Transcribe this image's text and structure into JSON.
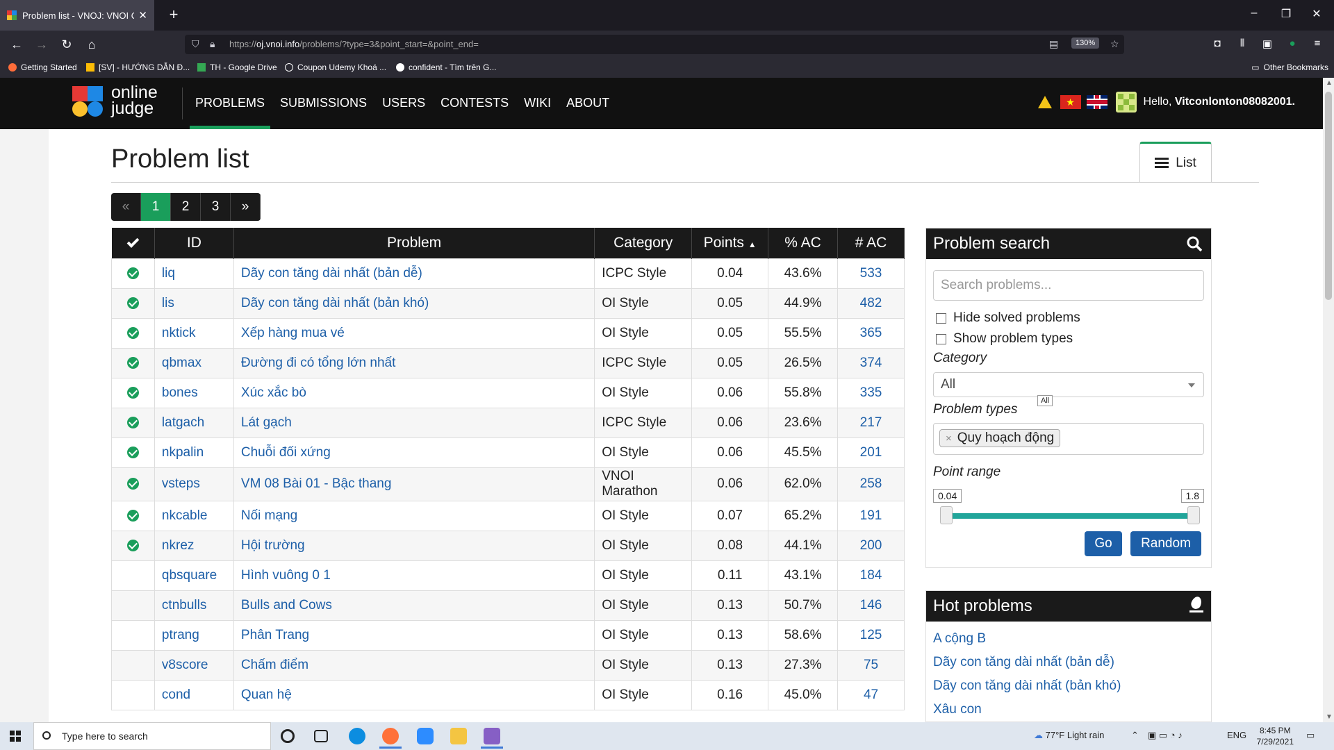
{
  "browser": {
    "tab_title": "Problem list - VNOJ: VNOI Onlin",
    "url_prefix": "https://",
    "url_host": "oj.vnoi.info",
    "url_path": "/problems/?type=3&point_start=&point_end=",
    "zoom": "130%",
    "bookmarks": [
      "Getting Started",
      "[SV] - HƯỚNG DẪN Đ...",
      "TH - Google Drive",
      "Coupon Udemy Khoá ...",
      "confident - Tìm trên G..."
    ],
    "other_bookmarks": "Other Bookmarks"
  },
  "site": {
    "logo_line1": "online",
    "logo_line2": "judge",
    "nav": [
      "PROBLEMS",
      "SUBMISSIONS",
      "USERS",
      "CONTESTS",
      "WIKI",
      "ABOUT"
    ],
    "hello_prefix": "Hello, ",
    "username": "Vitconlonton08082001."
  },
  "page": {
    "title": "Problem list",
    "list_tab": "List",
    "pager": [
      "«",
      "1",
      "2",
      "3",
      "»"
    ]
  },
  "table": {
    "headers": {
      "id": "ID",
      "problem": "Problem",
      "category": "Category",
      "points": "Points",
      "sort_indicator": "▲",
      "pct_ac": "% AC",
      "num_ac": "# AC"
    },
    "rows": [
      {
        "solved": true,
        "id": "liq",
        "name": "Dãy con tăng dài nhất (bản dễ)",
        "category": "ICPC Style",
        "points": "0.04",
        "pct": "43.6%",
        "ac": "533"
      },
      {
        "solved": true,
        "id": "lis",
        "name": "Dãy con tăng dài nhất (bản khó)",
        "category": "OI Style",
        "points": "0.05",
        "pct": "44.9%",
        "ac": "482"
      },
      {
        "solved": true,
        "id": "nktick",
        "name": "Xếp hàng mua vé",
        "category": "OI Style",
        "points": "0.05",
        "pct": "55.5%",
        "ac": "365"
      },
      {
        "solved": true,
        "id": "qbmax",
        "name": "Đường đi có tổng lớn nhất",
        "category": "ICPC Style",
        "points": "0.05",
        "pct": "26.5%",
        "ac": "374"
      },
      {
        "solved": true,
        "id": "bones",
        "name": "Xúc xắc bò",
        "category": "OI Style",
        "points": "0.06",
        "pct": "55.8%",
        "ac": "335"
      },
      {
        "solved": true,
        "id": "latgach",
        "name": "Lát gạch",
        "category": "ICPC Style",
        "points": "0.06",
        "pct": "23.6%",
        "ac": "217"
      },
      {
        "solved": true,
        "id": "nkpalin",
        "name": "Chuỗi đối xứng",
        "category": "OI Style",
        "points": "0.06",
        "pct": "45.5%",
        "ac": "201"
      },
      {
        "solved": true,
        "id": "vsteps",
        "name": "VM 08 Bài 01 - Bậc thang",
        "category": "VNOI Marathon",
        "points": "0.06",
        "pct": "62.0%",
        "ac": "258"
      },
      {
        "solved": true,
        "id": "nkcable",
        "name": "Nối mạng",
        "category": "OI Style",
        "points": "0.07",
        "pct": "65.2%",
        "ac": "191"
      },
      {
        "solved": true,
        "id": "nkrez",
        "name": "Hội trường",
        "category": "OI Style",
        "points": "0.08",
        "pct": "44.1%",
        "ac": "200"
      },
      {
        "solved": false,
        "id": "qbsquare",
        "name": "Hình vuông 0 1",
        "category": "OI Style",
        "points": "0.11",
        "pct": "43.1%",
        "ac": "184"
      },
      {
        "solved": false,
        "id": "ctnbulls",
        "name": "Bulls and Cows",
        "category": "OI Style",
        "points": "0.13",
        "pct": "50.7%",
        "ac": "146"
      },
      {
        "solved": false,
        "id": "ptrang",
        "name": "Phân Trang",
        "category": "OI Style",
        "points": "0.13",
        "pct": "58.6%",
        "ac": "125"
      },
      {
        "solved": false,
        "id": "v8score",
        "name": "Chấm điểm",
        "category": "OI Style",
        "points": "0.13",
        "pct": "27.3%",
        "ac": "75"
      },
      {
        "solved": false,
        "id": "cond",
        "name": "Quan hệ",
        "category": "OI Style",
        "points": "0.16",
        "pct": "45.0%",
        "ac": "47"
      }
    ]
  },
  "search": {
    "title": "Problem search",
    "placeholder": "Search problems...",
    "hide_solved": "Hide solved problems",
    "show_types": "Show problem types",
    "category_label": "Category",
    "category_value": "All",
    "category_tooltip": "All",
    "types_label": "Problem types",
    "selected_type": "Quy hoạch động",
    "point_range_label": "Point range",
    "range_min": "0.04",
    "range_max": "1.8",
    "go": "Go",
    "random": "Random"
  },
  "hot": {
    "title": "Hot problems",
    "items": [
      "A cộng B",
      "Dãy con tăng dài nhất (bản dễ)",
      "Dãy con tăng dài nhất (bản khó)",
      "Xâu con"
    ]
  },
  "taskbar": {
    "search_placeholder": "Type here to search",
    "weather": "77°F  Light rain",
    "lang": "ENG",
    "time": "8:45 PM",
    "date": "7/29/2021"
  },
  "colors": {
    "accent": "#1a9e5b",
    "link": "#1d5fa8",
    "header_bg": "#111111",
    "slider": "#21a59a"
  }
}
